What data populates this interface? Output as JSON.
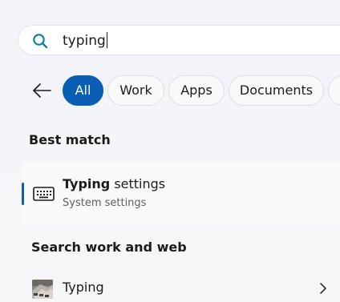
{
  "search": {
    "query": "typing"
  },
  "filters": {
    "chips": [
      {
        "label": "All",
        "active": true
      },
      {
        "label": "Work",
        "active": false
      },
      {
        "label": "Apps",
        "active": false
      },
      {
        "label": "Documents",
        "active": false
      },
      {
        "label": "",
        "active": false
      }
    ]
  },
  "best_match": {
    "header": "Best match",
    "title_bold": "Typing",
    "title_rest": " settings",
    "subtitle": "System settings",
    "icon": "keyboard-icon"
  },
  "search_web": {
    "header": "Search work and web",
    "items": [
      {
        "label": "Typing",
        "icon": "typing-thumbnail"
      }
    ]
  },
  "colors": {
    "accent": "#0a5fb4",
    "search_icon": "#0a7ea8"
  }
}
